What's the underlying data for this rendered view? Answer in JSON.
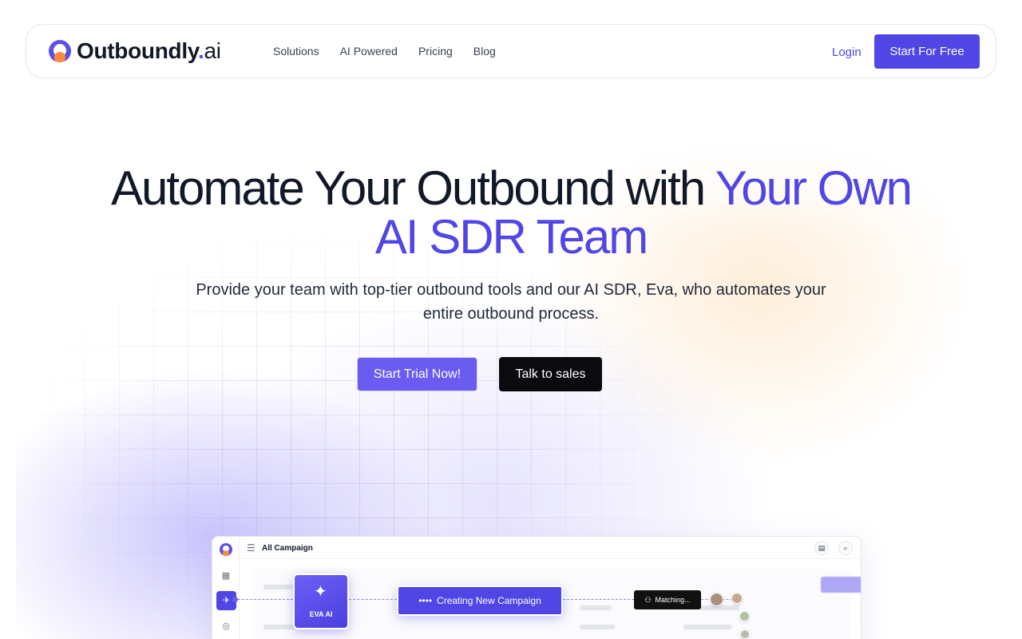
{
  "brand": {
    "name": "Outboundly",
    "dot": ".",
    "suffix": "ai",
    "accent_color": "#4f46e5",
    "logo_orange": "#ff8a3d"
  },
  "nav": {
    "items": [
      "Solutions",
      "AI Powered",
      "Pricing",
      "Blog"
    ],
    "login_label": "Login",
    "cta_label": "Start For Free"
  },
  "hero": {
    "title_part1": "Automate Your Outbound with ",
    "title_accent1": "Your Own",
    "title_accent2": "AI SDR Team",
    "subtitle_line1": "Provide your team with top-tier outbound tools and our AI SDR, Eva, who automates your",
    "subtitle_line2": "entire outbound process.",
    "primary_button": "Start Trial Now!",
    "secondary_button": "Talk to sales"
  },
  "app_preview": {
    "page_title": "All Campaign",
    "eva_label": "EVA AI",
    "creating_label": "Creating New Campaign",
    "matching_label": "Matching..."
  }
}
